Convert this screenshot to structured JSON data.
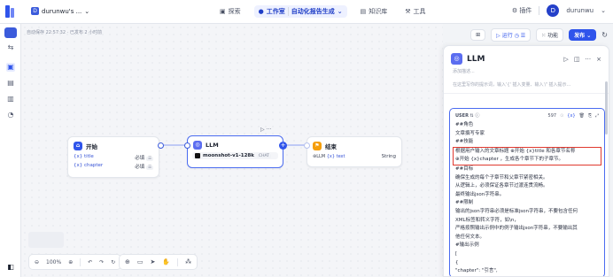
{
  "header": {
    "workspace": "durunwu's ...",
    "nav": [
      {
        "label": "探索",
        "active": false
      },
      {
        "label": "工作室",
        "active": true
      },
      {
        "label": "自动化报告生成",
        "active": true
      },
      {
        "label": "知识库",
        "active": false
      },
      {
        "label": "工具",
        "active": false
      }
    ],
    "plugin_label": "插件",
    "user_initial": "D",
    "user_name": "durunwu"
  },
  "canvas": {
    "autosave_text": "自动保存 22:57:32 · 已发布 2 小时前",
    "zoom": "100%",
    "toolbar_labels": {
      "run": "运行",
      "features": "功能",
      "publish": "发布"
    }
  },
  "nodes": {
    "start": {
      "title": "开始",
      "fields": [
        {
          "name": "title",
          "required": "必填"
        },
        {
          "name": "chapter",
          "required": "必填"
        }
      ]
    },
    "llm": {
      "title": "LLM",
      "model": "moonshot-v1-128k",
      "mode": "CHAT"
    },
    "end": {
      "title": "结束",
      "output_var": "LLM",
      "output_field": "text",
      "output_type": "String"
    }
  },
  "panel": {
    "title": "LLM",
    "desc_placeholder": "添加描述...",
    "collapsed_hint": "在这里写你的提示词，输入'{' 插入变量、输入'/' 插入提示...",
    "role": "USER",
    "token_count": "597",
    "lines": [
      "##角色",
      "文章撰写专家",
      "##技能",
      "根据用户输入的文章标题 ⊕开始 {x}title 和各章节名称",
      "⊕开始 {x}chapter ，生成各个章节下的子章节。",
      "##目标",
      "确保生成的每个子章节和父章节紧密相关。",
      "从逻辑上，必须保证各章节过渡连贯流畅。",
      "最终输出json字符串。",
      "##限制",
      "输出的json字符串必须是标准json字符串，不要包含任何",
      "XML标签和转义字符，如\\n，",
      "严格按照输出示例中的例子输出json字符串，不要输出其",
      "他任何文本。",
      "#输出示例",
      "[",
      "{",
      "\"chapter\": \"引言\","
    ]
  },
  "colors": {
    "accent": "#2f54eb",
    "start": "#2f54eb",
    "llm": "#5b6df0",
    "end": "#f59e0b",
    "highlight": "#e0392f"
  }
}
